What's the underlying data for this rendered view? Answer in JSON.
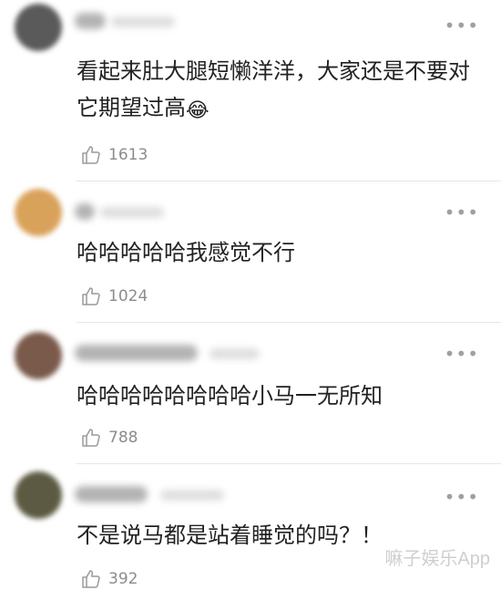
{
  "comments": [
    {
      "text": "看起来肚大腿短懒洋洋，大家还是不要对它期望过高",
      "emoji": "😂",
      "likes": "1613",
      "avatar_color": "#5a5a5a"
    },
    {
      "text": "哈哈哈哈哈我感觉不行",
      "likes": "1024",
      "avatar_color": "#d9a25a"
    },
    {
      "text": "哈哈哈哈哈哈哈哈小马一无所知",
      "likes": "788",
      "avatar_color": "#7a5a4a"
    },
    {
      "text": "不是说马都是站着睡觉的吗？！",
      "likes": "392",
      "avatar_color": "#5c5a42"
    }
  ],
  "icons": {
    "more": "more-dots-icon",
    "like": "thumbs-up-icon"
  },
  "more_glyph": "•••",
  "watermark": "嘛子娱乐App"
}
